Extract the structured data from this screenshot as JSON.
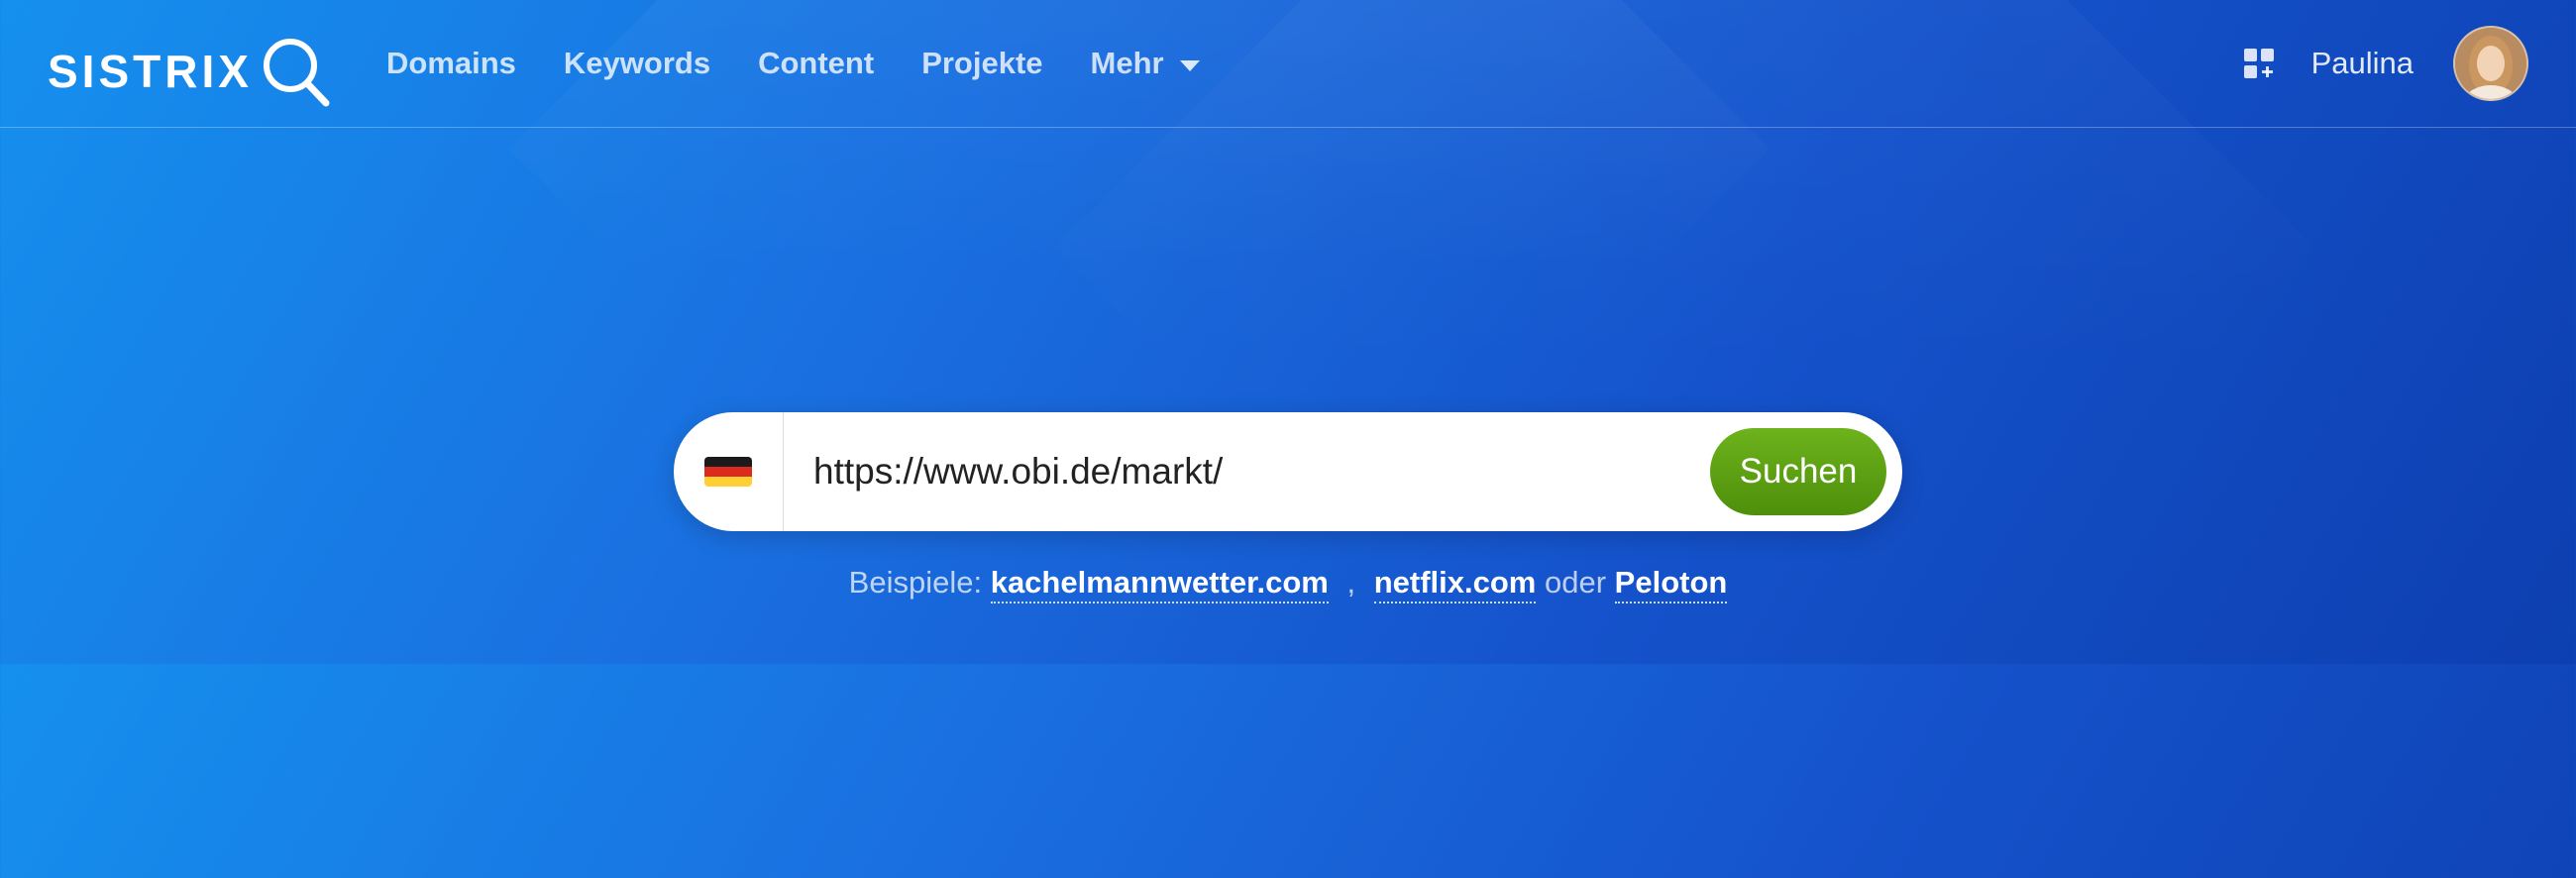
{
  "brand": {
    "name": "SISTRIX"
  },
  "nav": {
    "items": [
      {
        "label": "Domains"
      },
      {
        "label": "Keywords"
      },
      {
        "label": "Content"
      },
      {
        "label": "Projekte"
      },
      {
        "label": "Mehr"
      }
    ]
  },
  "user": {
    "name": "Paulina"
  },
  "search": {
    "country_flag": "de",
    "value": "https://www.obi.de/markt/",
    "button_label": "Suchen"
  },
  "examples": {
    "prefix": "Beispiele:",
    "items": [
      "kachelmannwetter.com",
      "netflix.com",
      "Peloton"
    ],
    "comma": ",",
    "or": "oder"
  },
  "colors": {
    "button_green": "#5fa515",
    "bg_start": "#1590ee",
    "bg_end": "#0d3fb0",
    "flag": [
      "#000000",
      "#dd0000",
      "#ffce00"
    ]
  }
}
